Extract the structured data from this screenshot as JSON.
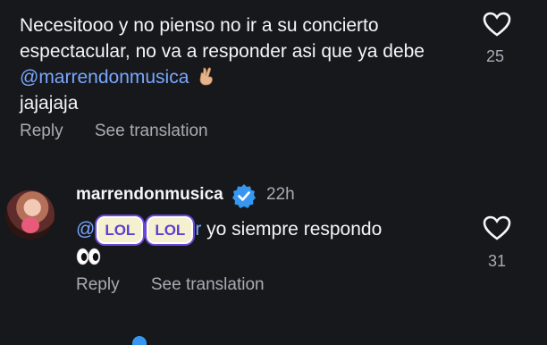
{
  "comment1": {
    "text_before": "Necesitooo y no pienso no ir a su concierto espectacular, no va a responder asi que ya debe ",
    "mention": "@marrendonmusica",
    "text_after": "jajajaja",
    "emoji": "crossed-fingers-icon",
    "likes": "25",
    "reply_label": "Reply",
    "translate_label": "See translation"
  },
  "comment2": {
    "username": "marrendonmusica",
    "time": "22h",
    "mention_start": "@",
    "sticker1": "LOL",
    "sticker2": "LOL",
    "mention_end": "r",
    "text": " yo siempre respondo",
    "emoji": "eyes-icon",
    "likes": "31",
    "reply_label": "Reply",
    "translate_label": "See translation"
  },
  "colors": {
    "background": "#16181c",
    "mention": "#7aa7ff",
    "verified": "#3797f0",
    "secondary": "#a8acb3"
  }
}
